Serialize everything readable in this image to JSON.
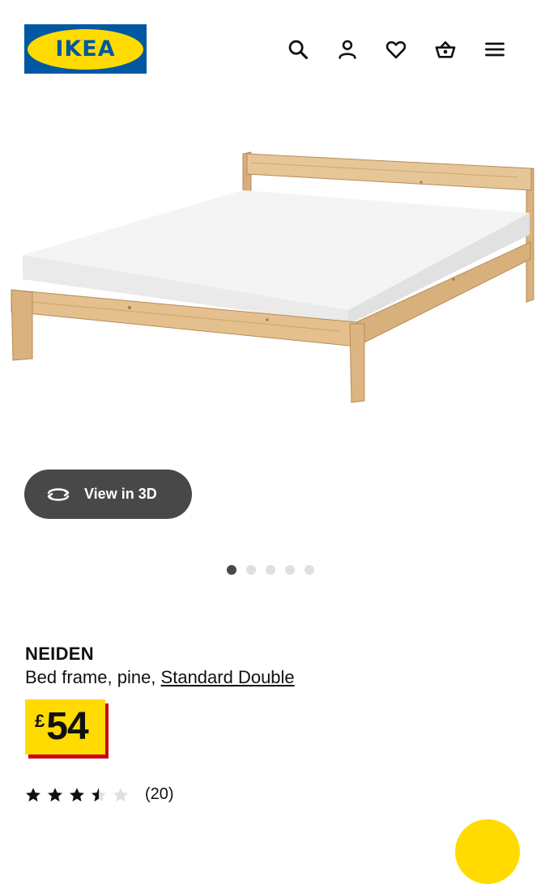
{
  "header": {
    "logo_text": "IKEA",
    "icons": [
      "search-icon",
      "user-icon",
      "heart-icon",
      "basket-icon",
      "menu-icon"
    ]
  },
  "view3d": {
    "label": "View in 3D",
    "icon": "rotate-icon"
  },
  "carousel": {
    "count": 5,
    "active_index": 0
  },
  "product": {
    "name": "NEIDEN",
    "description_prefix": "Bed frame, pine, ",
    "size_link": "Standard Double",
    "price_currency": "£",
    "price_amount": "54",
    "rating": 3.5,
    "rating_max": 5,
    "review_count": "(20)"
  },
  "colors": {
    "ikea_blue": "#0058a3",
    "ikea_yellow": "#ffdb00",
    "price_red": "#cc0008",
    "dark_button": "#484848"
  }
}
